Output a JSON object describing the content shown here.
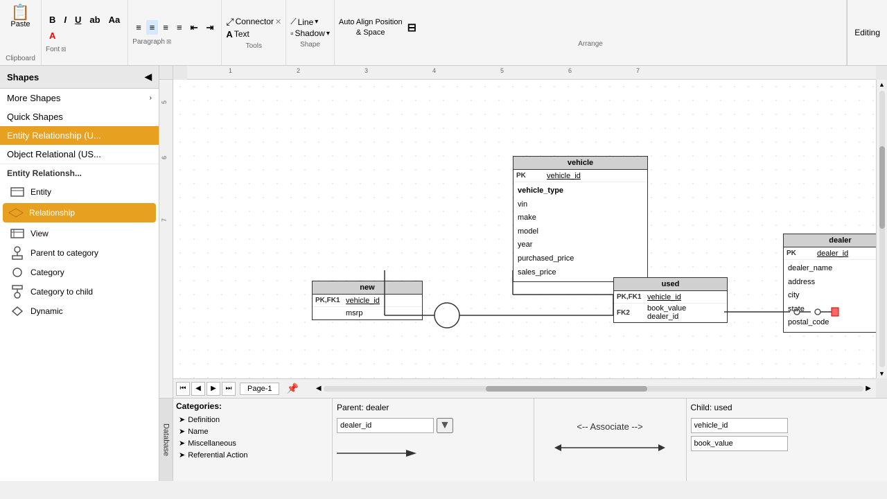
{
  "toolbar": {
    "clipboard_label": "Clipboard",
    "paste_label": "Paste",
    "font_label": "Font",
    "paragraph_label": "Paragraph",
    "tools_label": "Tools",
    "shape_label": "Shape",
    "arrange_label": "Arrange",
    "connector_tab": "Connector",
    "line_btn": "Line",
    "text_btn": "Text",
    "shadow_btn": "Shadow",
    "auto_align": "Auto Align Position",
    "space": "& Space",
    "editing": "Editing",
    "bold": "B",
    "italic": "I",
    "underline": "U",
    "strikethrough": "ab",
    "font_size": "Aa"
  },
  "sidebar": {
    "title": "Shapes",
    "items": [
      {
        "label": "More Shapes",
        "arrow": "›"
      },
      {
        "label": "Quick Shapes"
      },
      {
        "label": "Entity Relationship (U...",
        "active": true
      },
      {
        "label": "Object Relational (US..."
      }
    ],
    "section_title": "Entity Relationsh...",
    "shapes": [
      {
        "label": "Entity",
        "icon": "entity"
      },
      {
        "label": "Relationship",
        "icon": "relationship",
        "selected": true
      },
      {
        "label": "View",
        "icon": "view"
      },
      {
        "label": "Parent to category",
        "icon": "parent-cat"
      },
      {
        "label": "Category",
        "icon": "category"
      },
      {
        "label": "Category to child",
        "icon": "cat-child"
      },
      {
        "label": "Dynamic",
        "icon": "dynamic"
      }
    ]
  },
  "canvas": {
    "ruler_marks": [
      "1",
      "2",
      "3",
      "4",
      "5",
      "6",
      "7"
    ],
    "entities": {
      "vehicle": {
        "title": "vehicle",
        "pk_field": "vehicle_id",
        "fields": [
          "vehicle_type",
          "vin",
          "make",
          "model",
          "year",
          "purchased_price",
          "sales_price"
        ]
      },
      "new": {
        "title": "new",
        "pk_label": "PK,FK1",
        "pk_field": "vehicle_id",
        "other_field": "msrp"
      },
      "used": {
        "title": "used",
        "pk_label": "PK,FK1",
        "pk_field": "vehicle_id",
        "fk_label": "FK2",
        "fk_fields": [
          "book_value",
          "dealer_id"
        ]
      },
      "dealer": {
        "title": "dealer",
        "pk_label": "PK",
        "pk_field": "dealer_id",
        "fields": [
          "dealer_name",
          "address",
          "city",
          "state",
          "postal_code"
        ]
      }
    },
    "page_label": "Page-1"
  },
  "bottom_panel": {
    "db_tab": "Database",
    "categories_title": "Categories:",
    "categories": [
      "Definition",
      "Name",
      "Miscellaneous",
      "Referential Action"
    ],
    "parent_label": "Parent: dealer",
    "parent_field": "dealer_id",
    "assoc_label": "<-- Associate -->",
    "child_label": "Child: used",
    "child_field": "vehicle_id",
    "child_field2": "book_value"
  }
}
